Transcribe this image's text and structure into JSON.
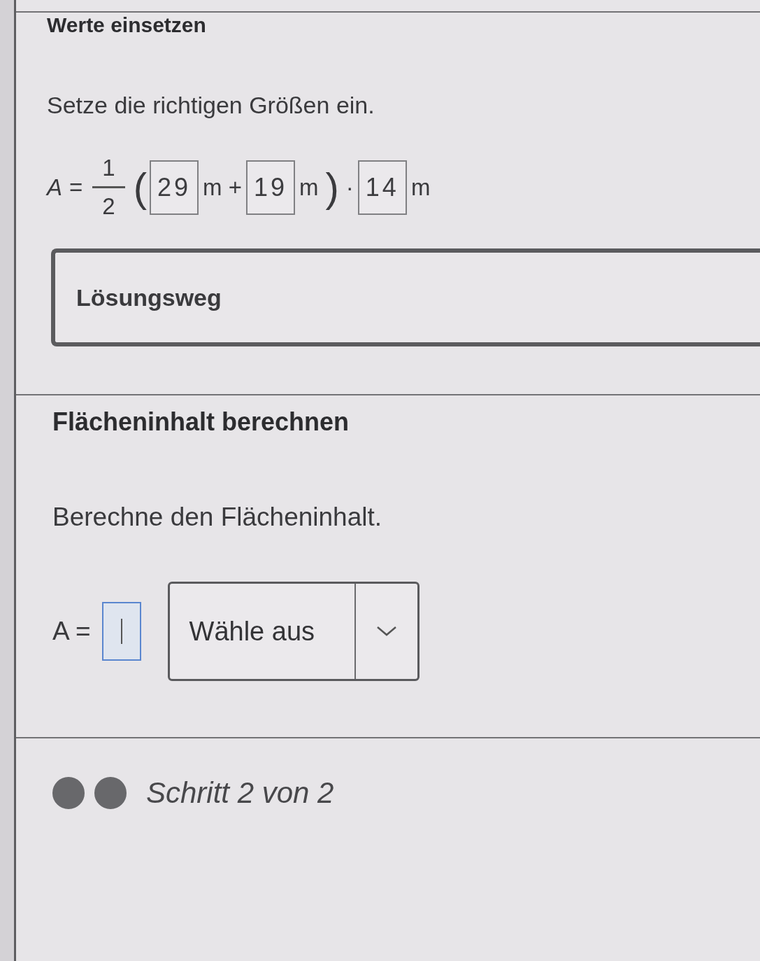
{
  "sections": [
    {
      "heading": "Werte einsetzen",
      "instruction": "Setze die richtigen Größen ein.",
      "formula": [
        {
          "kind": "variable",
          "text": "A"
        },
        {
          "kind": "text",
          "text": "="
        },
        {
          "kind": "fraction",
          "numerator": "1",
          "denominator": "2"
        },
        {
          "kind": "paren",
          "text": "("
        },
        {
          "kind": "input",
          "value": "29",
          "focused": false
        },
        {
          "kind": "text",
          "text": "m +"
        },
        {
          "kind": "input",
          "value": "19",
          "focused": false
        },
        {
          "kind": "text",
          "text": "m"
        },
        {
          "kind": "paren",
          "text": ")"
        },
        {
          "kind": "text",
          "text": "·"
        },
        {
          "kind": "input",
          "value": "14",
          "focused": false
        },
        {
          "kind": "text",
          "text": "m"
        }
      ],
      "solution_button": {
        "label": "Lösungsweg"
      }
    },
    {
      "heading": "Flächeninhalt berechnen",
      "instruction": "Berechne den Flächeninhalt.",
      "formula": [
        {
          "kind": "text",
          "text": "A ="
        },
        {
          "kind": "input",
          "focused": true
        },
        {
          "kind": "dropdown",
          "placeholder": "Wähle aus"
        }
      ]
    }
  ],
  "progress": {
    "steps": [
      {
        "done": true
      },
      {
        "done": true
      }
    ],
    "label": "Schritt 2 von 2"
  }
}
